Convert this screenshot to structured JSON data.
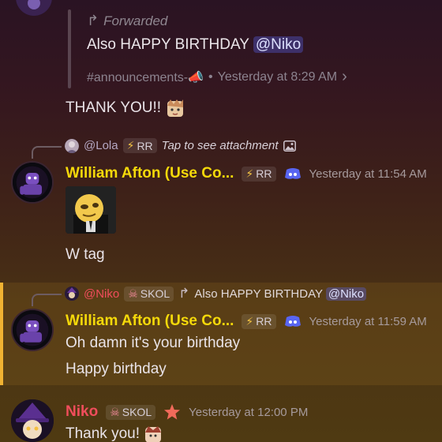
{
  "forwarded": {
    "label": "Forwarded",
    "text_prefix": "Also HAPPY BIRTHDAY ",
    "mention": "@Niko",
    "channel": "#announcements-📣",
    "separator": "•",
    "time": "Yesterday at 8:29 AM",
    "chevron": "›"
  },
  "thank_you_msg": "THANK YOU!!",
  "reply1": {
    "user": "@Lola",
    "tag": "RR",
    "text": "Tap to see attachment"
  },
  "msg1": {
    "username": "William Afton (Use Co...",
    "tag": "RR",
    "time": "Yesterday at 11:54 AM",
    "text": "W tag"
  },
  "reply2": {
    "user": "@Niko",
    "tag": "SKOL",
    "text_prefix": "Also HAPPY BIRTHDAY ",
    "mention": "@Niko"
  },
  "msg2": {
    "username": "William Afton (Use Co...",
    "tag": "RR",
    "time": "Yesterday at 11:59 AM",
    "line1": "Oh damn it's your birthday",
    "line2": "Happy birthday"
  },
  "msg3": {
    "username": "Niko",
    "tag": "SKOL",
    "time": "Yesterday at 12:00 PM",
    "text": "Thank you!"
  },
  "colors": {
    "william_name": "#f5d90a",
    "niko_name": "#f04d5c",
    "highlight": "#f0b232",
    "mention_bg": "#5865f2"
  }
}
